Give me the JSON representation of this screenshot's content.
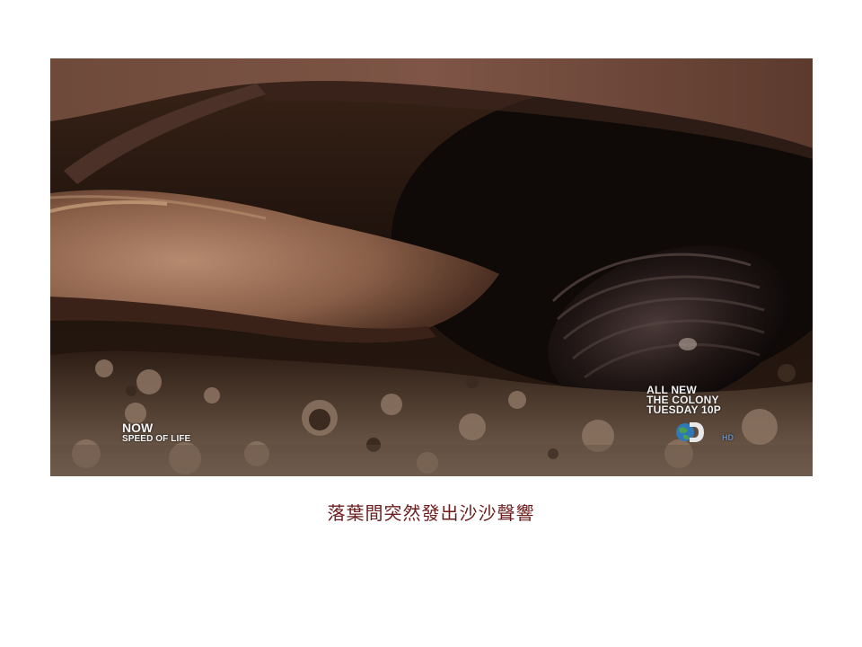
{
  "video": {
    "promo": {
      "line1": "ALL NEW",
      "line2": "THE COLONY",
      "line3": "TUESDAY 10P"
    },
    "now": {
      "label": "NOW",
      "show": "SPEED OF LIFE"
    },
    "network_badge": "HD"
  },
  "caption": {
    "text": "落葉間突然發出沙沙聲響"
  },
  "colors": {
    "caption": "#6b1d1d",
    "overlay_text": "#f3f3f3",
    "hd_badge": "#5a8fc9"
  },
  "icons": {
    "network_logo": "discovery-globe-d-logo"
  }
}
